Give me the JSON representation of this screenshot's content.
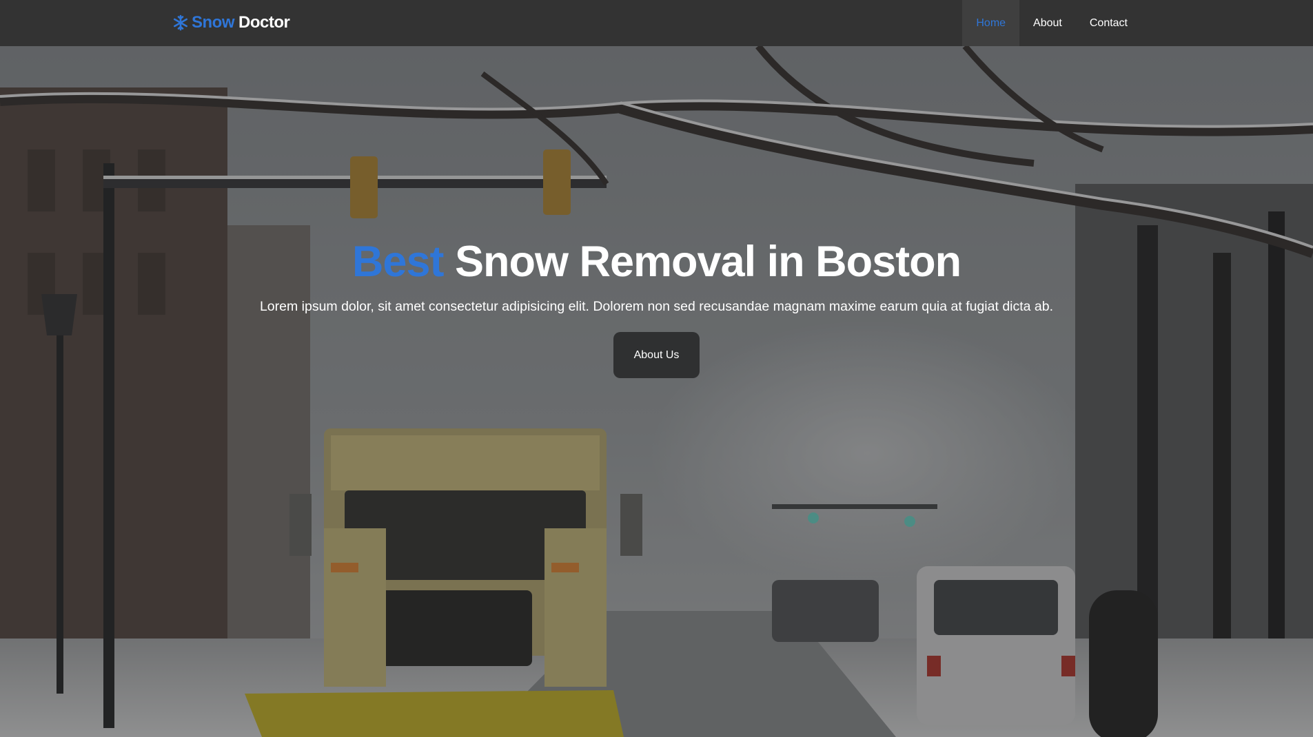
{
  "brand": {
    "icon": "snowflake-icon",
    "word1": "Snow",
    "word2": "Doctor",
    "accent_color": "#2f76d8"
  },
  "nav": {
    "items": [
      {
        "label": "Home",
        "active": true
      },
      {
        "label": "About",
        "active": false
      },
      {
        "label": "Contact",
        "active": false
      }
    ]
  },
  "hero": {
    "title_accent": "Best",
    "title_rest": "Snow Removal in Boston",
    "subtitle": "Lorem ipsum dolor, sit amet consectetur adipisicing elit. Dolorem non sed recusandae magnam maxime earum quia at fugiat dicta ab.",
    "button_label": "About Us"
  }
}
